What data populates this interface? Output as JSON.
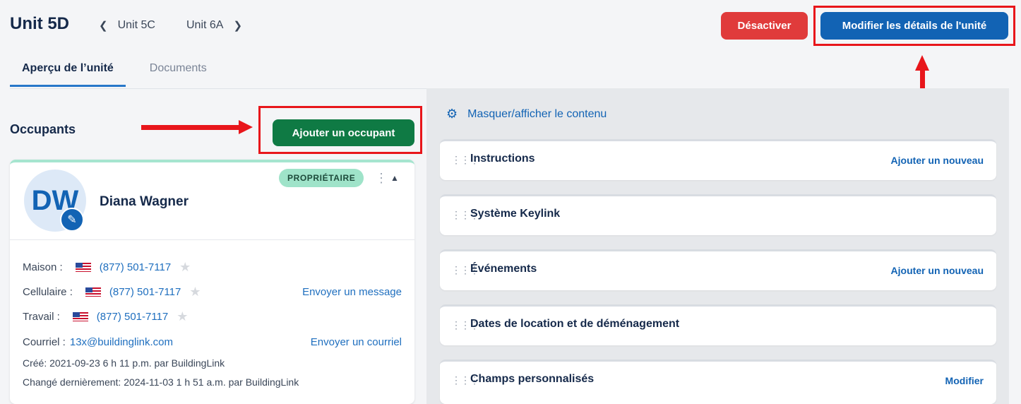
{
  "header": {
    "title": "Unit 5D",
    "prev_unit": "Unit 5C",
    "next_unit": "Unit 6A",
    "deactivate_label": "Désactiver",
    "modify_label": "Modifier les détails de l'unité"
  },
  "tabs": [
    {
      "label": "Aperçu de l’unité",
      "active": true
    },
    {
      "label": "Documents",
      "active": false
    }
  ],
  "occupants": {
    "title": "Occupants",
    "add_label": "Ajouter un occupant",
    "card": {
      "initials": "DW",
      "name": "Diana Wagner",
      "role": "PROPRIÉTAIRE",
      "home_label": "Maison :",
      "home_phone": "(877) 501-7117",
      "cell_label": "Cellulaire :",
      "cell_phone": "(877) 501-7117",
      "send_message": "Envoyer un message",
      "work_label": "Travail :",
      "work_phone": "(877) 501-7117",
      "email_label": "Courriel :",
      "email": "13x@buildinglink.com",
      "send_email": "Envoyer un courriel",
      "created": "Créé:  2021-09-23 6 h 11 p.m. par BuildingLink",
      "changed": "Changé dernièrement:  2024-11-03 1 h 51 a.m. par BuildingLink"
    }
  },
  "panel": {
    "toggle_label": "Masquer/afficher le contenu",
    "sections": [
      {
        "title": "Instructions",
        "action": "Ajouter un nouveau"
      },
      {
        "title": "Système Keylink",
        "action": ""
      },
      {
        "title": "Événements",
        "action": "Ajouter un nouveau"
      },
      {
        "title": "Dates de location et de déménagement",
        "action": ""
      },
      {
        "title": "Champs personnalisés",
        "action": "Modifier"
      }
    ]
  },
  "colors": {
    "primary": "#1263b4",
    "danger": "#e03b3b",
    "success": "#0f7a44",
    "highlight": "#e8161b"
  }
}
